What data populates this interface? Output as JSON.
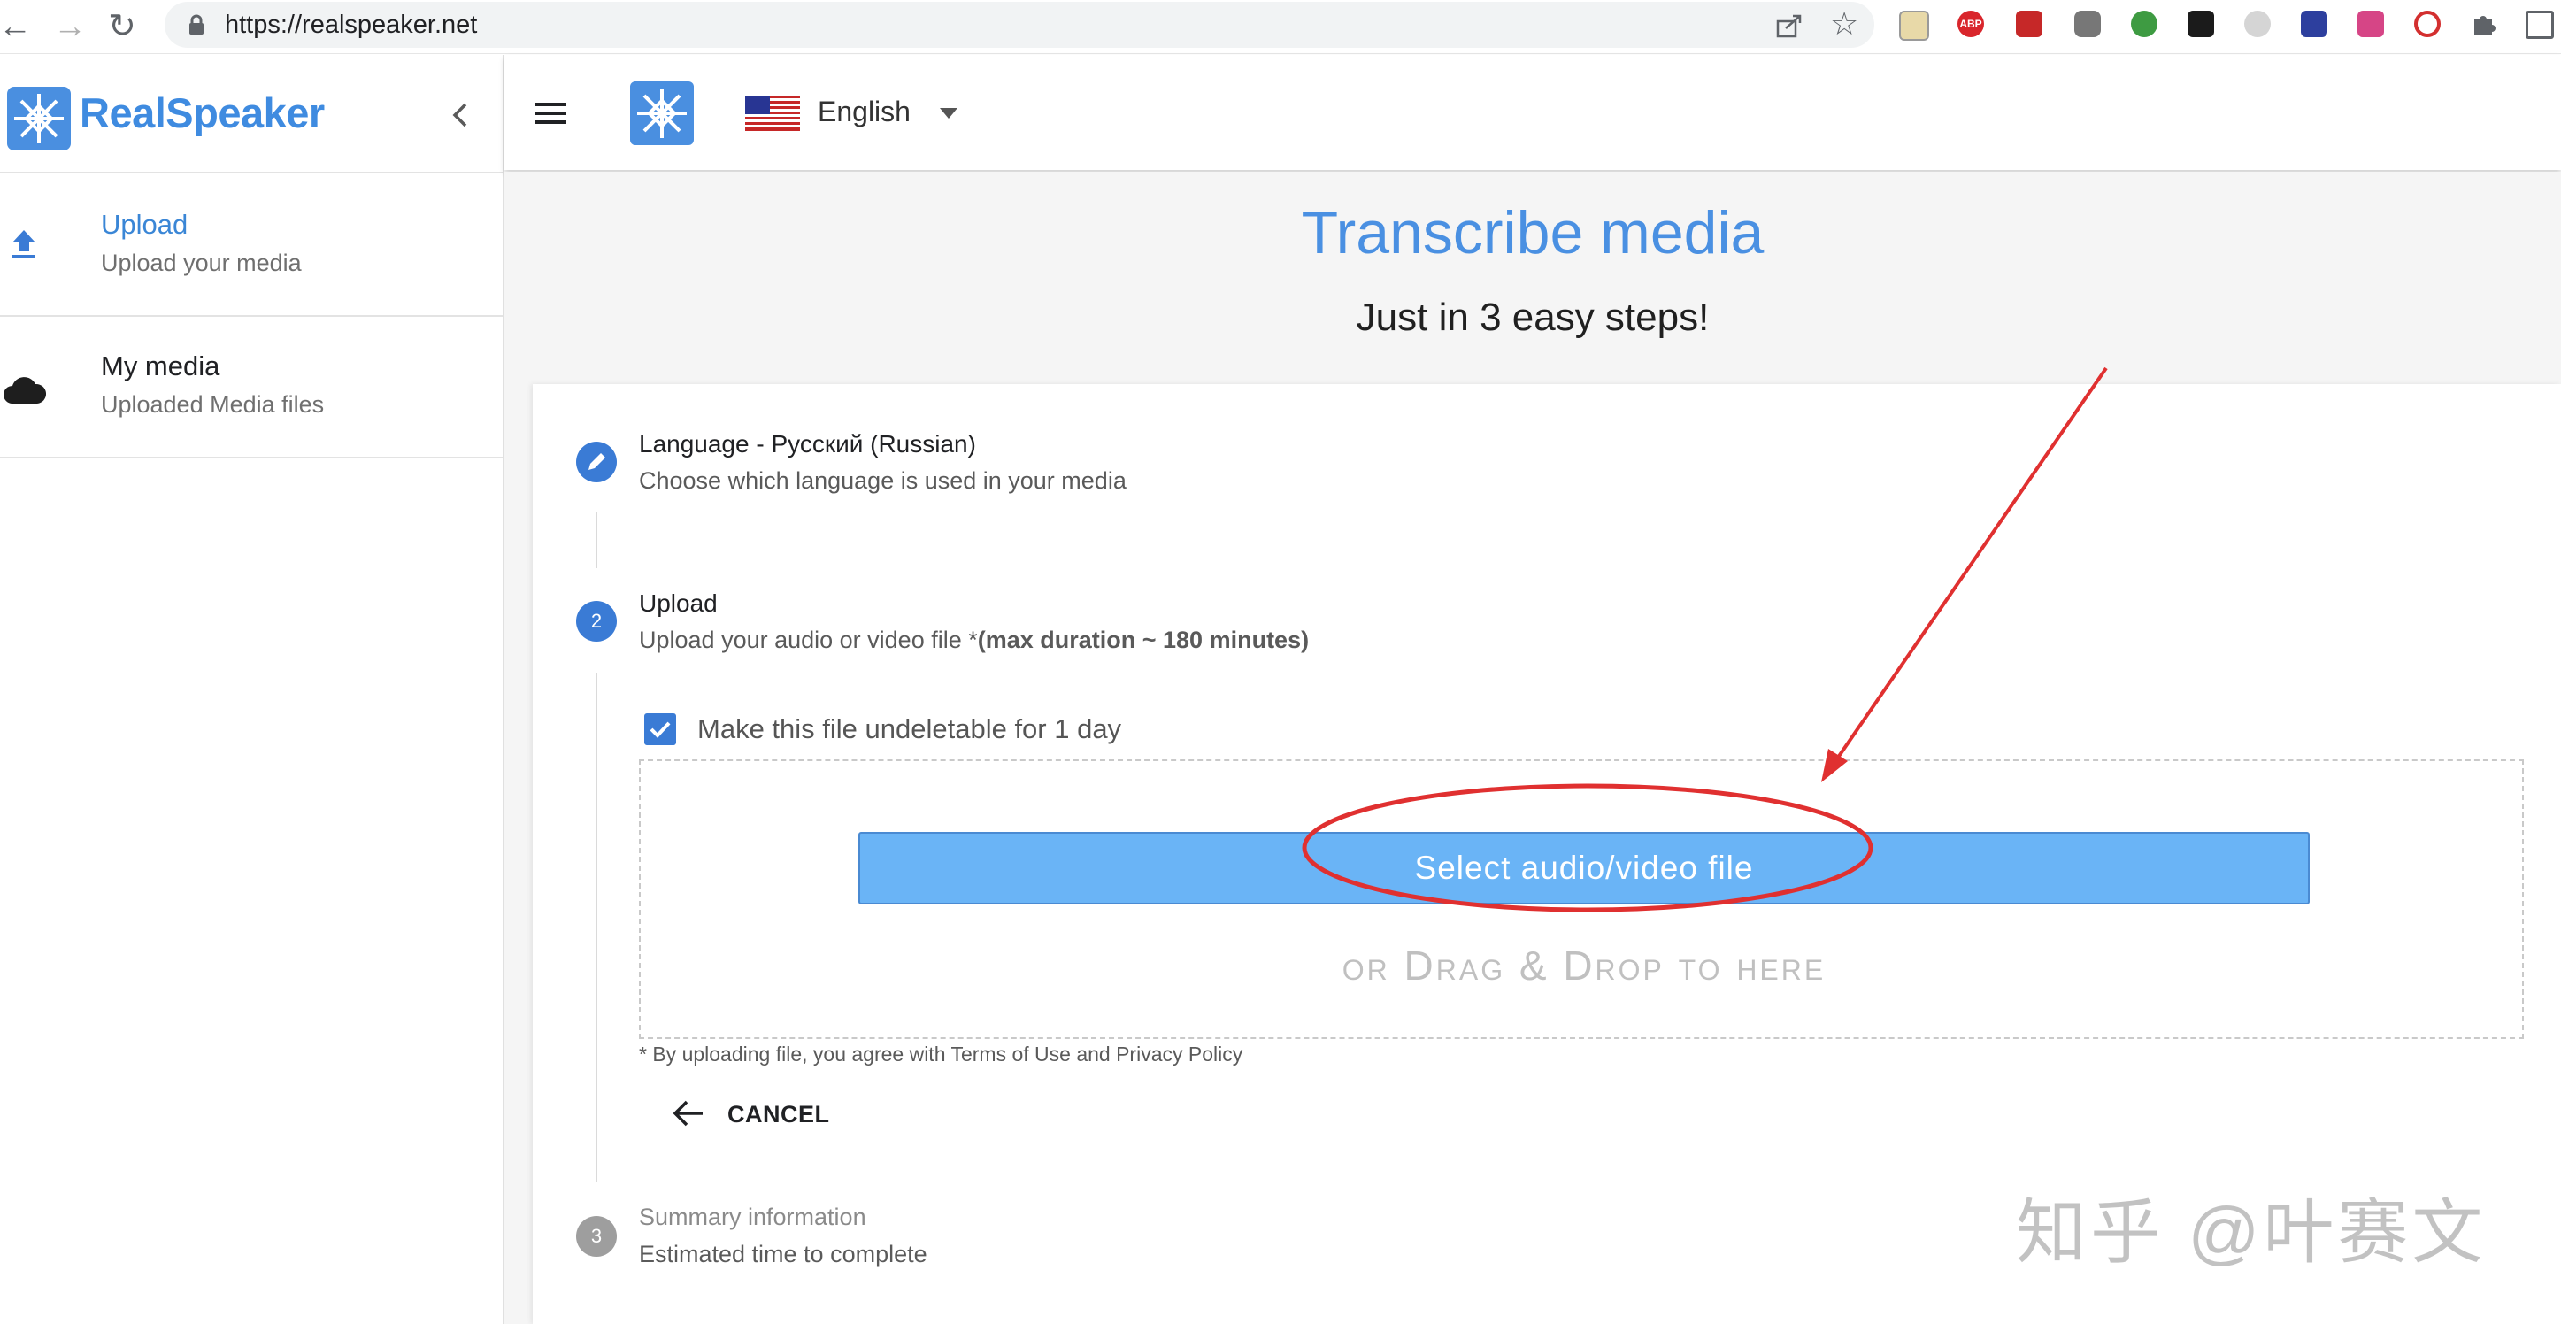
{
  "browser": {
    "url": "https://realspeaker.net",
    "extension_labels": [
      "ABP"
    ]
  },
  "sidebar": {
    "brand": "RealSpeaker",
    "items": [
      {
        "title": "Upload",
        "subtitle": "Upload your media"
      },
      {
        "title": "My media",
        "subtitle": "Uploaded Media files"
      }
    ]
  },
  "topbar": {
    "language": "English"
  },
  "main": {
    "title": "Transcribe media",
    "subtitle": "Just in 3 easy steps!",
    "steps": [
      {
        "number": "",
        "title": "Language - Русский (Russian)",
        "subtitle": "Choose which language is used in your media"
      },
      {
        "number": "2",
        "title": "Upload",
        "subtitle": "Upload your audio or video file *",
        "subtitle_bold": "(max duration ~ 180 minutes)"
      },
      {
        "number": "3",
        "title": "Summary information",
        "subtitle": "Estimated time to complete"
      }
    ],
    "checkbox_label": "Make this file undeletable for 1 day",
    "select_button": "Select audio/video file",
    "drag_drop": "or Drag & Drop to here",
    "terms": "* By uploading file, you agree with Terms of Use and Privacy Policy",
    "cancel": "CANCEL"
  },
  "watermark": "知乎 @叶赛文",
  "colors": {
    "accent": "#4a90e2",
    "button": "#6ab4f6",
    "annotation": "#e03030"
  }
}
